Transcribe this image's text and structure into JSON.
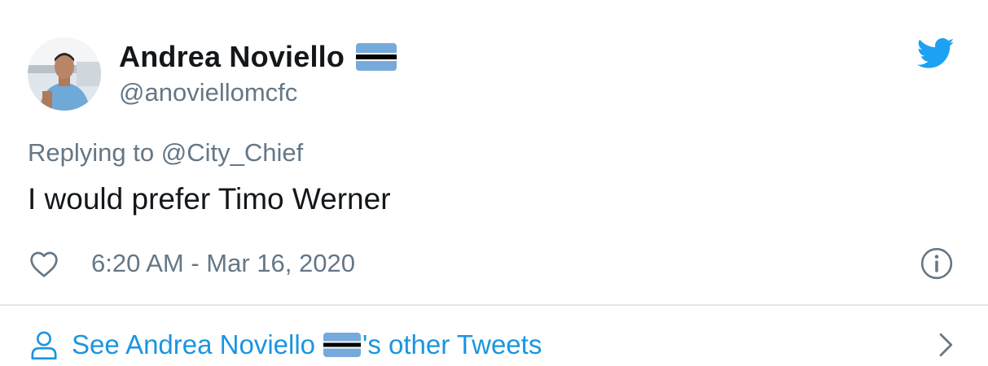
{
  "author": {
    "display_name": "Andrea Noviello",
    "handle": "@anoviellomcfc",
    "avatar_icon": "profile-photo",
    "flag_icon": "botswana-flag-emoji"
  },
  "tweet": {
    "replying_prefix": "Replying to",
    "replying_to": "@City_Chief",
    "text": "I would prefer Timo Werner",
    "timestamp": "6:20 AM - Mar 16, 2020"
  },
  "footer": {
    "see_prefix": "See Andrea Noviello",
    "see_suffix": "'s other Tweets"
  },
  "icons": {
    "brand": "twitter-bird-icon",
    "like": "heart-icon",
    "info": "info-icon",
    "person": "person-icon",
    "chevron": "chevron-right-icon"
  },
  "colors": {
    "twitter_blue": "#1da1f2",
    "link_blue": "#1b95e0",
    "secondary_text": "#657786",
    "primary_text": "#14171a",
    "divider": "#e1e8ed",
    "flag_light_blue": "#75aadb"
  }
}
